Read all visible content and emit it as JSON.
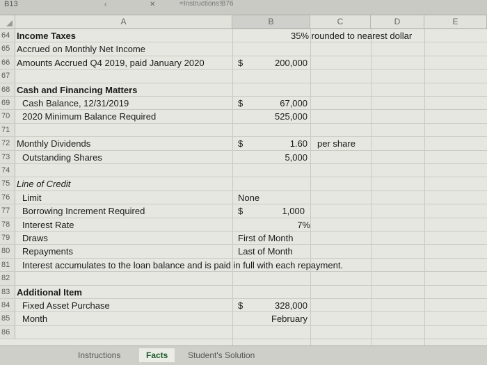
{
  "formula_bar": {
    "name_box": "B13",
    "formula_text": "=Instructions!B76",
    "toolbar_glyphs": [
      "‹",
      "✕"
    ]
  },
  "columns": [
    "A",
    "B",
    "C",
    "D",
    "E"
  ],
  "rows": [
    {
      "num": "64",
      "a": "Income Taxes",
      "a_style": "bold",
      "b_sym": "",
      "b_val": "",
      "c": "35% rounded to nearest dollar",
      "d": ""
    },
    {
      "num": "65",
      "a": "Accrued on Monthly Net Income",
      "a_style": "",
      "b_sym": "",
      "b_val": "",
      "c": "",
      "d": ""
    },
    {
      "num": "66",
      "a": "Amounts Accrued Q4 2019, paid January 2020",
      "a_style": "",
      "b_sym": "$",
      "b_val": "200,000",
      "c": "",
      "d": ""
    },
    {
      "num": "67",
      "a": "",
      "a_style": "",
      "b_sym": "",
      "b_val": "",
      "c": "",
      "d": ""
    },
    {
      "num": "68",
      "a": "Cash and Financing Matters",
      "a_style": "bold",
      "b_sym": "",
      "b_val": "",
      "c": "",
      "d": ""
    },
    {
      "num": "69",
      "a": "Cash Balance, 12/31/2019",
      "a_style": "indent",
      "b_sym": "$",
      "b_val": "67,000",
      "c": "",
      "d": ""
    },
    {
      "num": "70",
      "a": "2020 Minimum Balance Required",
      "a_style": "indent",
      "b_sym": "",
      "b_val": "525,000",
      "c": "",
      "d": ""
    },
    {
      "num": "71",
      "a": "",
      "a_style": "",
      "b_sym": "",
      "b_val": "",
      "c": "",
      "d": ""
    },
    {
      "num": "72",
      "a": "Monthly Dividends",
      "a_style": "",
      "b_sym": "$",
      "b_val": "1.60",
      "c": "per share",
      "d": ""
    },
    {
      "num": "73",
      "a": "Outstanding Shares",
      "a_style": "indent",
      "b_sym": "",
      "b_val": "5,000",
      "c": "",
      "d": ""
    },
    {
      "num": "74",
      "a": "",
      "a_style": "",
      "b_sym": "",
      "b_val": "",
      "c": "",
      "d": ""
    },
    {
      "num": "75",
      "a": "Line of Credit",
      "a_style": "italic",
      "b_sym": "",
      "b_val": "",
      "c": "",
      "d": ""
    },
    {
      "num": "76",
      "a": "Limit",
      "a_style": "indent",
      "b_text": "None",
      "c": "",
      "d": ""
    },
    {
      "num": "77",
      "a": "Borrowing Increment Required",
      "a_style": "indent",
      "b_sym": "$",
      "b_val": "1,000",
      "c": "",
      "d": ""
    },
    {
      "num": "78",
      "a": "Interest Rate",
      "a_style": "indent",
      "b_val": "7%",
      "c": "",
      "d": ""
    },
    {
      "num": "79",
      "a": "Draws",
      "a_style": "indent",
      "b_text": "First of Month",
      "c": "",
      "d": ""
    },
    {
      "num": "80",
      "a": "Repayments",
      "a_style": "indent",
      "b_text": "Last of Month",
      "c": "",
      "d": ""
    },
    {
      "num": "81",
      "a": "Interest accumulates to the loan balance and is paid in full with each repayment.",
      "a_style": "indent",
      "c": "",
      "d": ""
    },
    {
      "num": "82",
      "a": "",
      "a_style": "",
      "c": "",
      "d": ""
    },
    {
      "num": "83",
      "a": "Additional Item",
      "a_style": "bold",
      "c": "",
      "d": ""
    },
    {
      "num": "84",
      "a": "Fixed Asset Purchase",
      "a_style": "indent",
      "b_sym": "$",
      "b_val": "328,000",
      "c": "",
      "d": ""
    },
    {
      "num": "85",
      "a": "Month",
      "a_style": "indent",
      "b_val": "February",
      "c": "",
      "d": ""
    },
    {
      "num": "86",
      "a": "",
      "a_style": "",
      "c": "",
      "d": ""
    }
  ],
  "sheet_tabs": [
    "Instructions",
    "Facts",
    "Student's Solution"
  ],
  "active_tab": "Facts",
  "colors": {
    "active_tab_text": "#1c5a2a",
    "grid_bg": "#e7e7e1"
  }
}
